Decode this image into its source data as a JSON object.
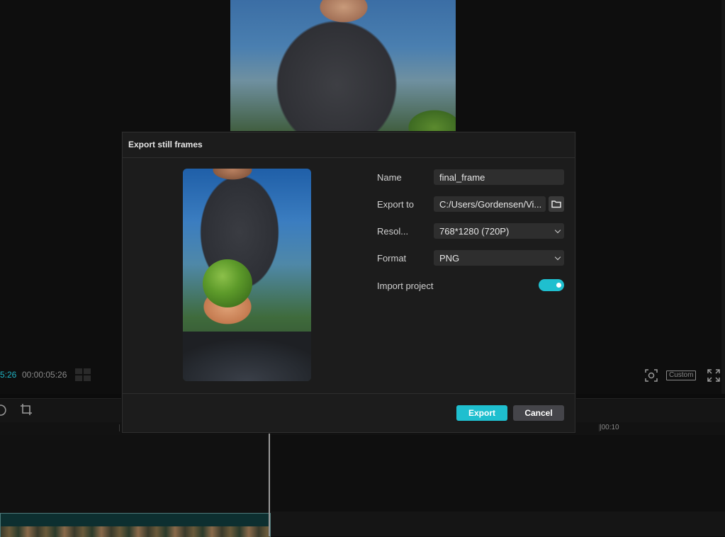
{
  "editor": {
    "timecode_current": "5:26",
    "timecode_total": "00:00:05:26",
    "ratio_label": "Custom",
    "ruler_label": "|00:10"
  },
  "dialog": {
    "title": "Export still frames",
    "fields": {
      "name_label": "Name",
      "name_value": "final_frame",
      "export_to_label": "Export to",
      "export_to_value": "C:/Users/Gordensen/Vi...",
      "resolution_label": "Resol...",
      "resolution_value": "768*1280 (720P)",
      "format_label": "Format",
      "format_value": "PNG",
      "import_project_label": "Import project",
      "import_project_enabled": true
    },
    "buttons": {
      "export": "Export",
      "cancel": "Cancel"
    }
  },
  "colors": {
    "accent": "#1fbfcf",
    "dialog_bg": "#1c1c1c",
    "field_bg": "#2e2e2e"
  }
}
